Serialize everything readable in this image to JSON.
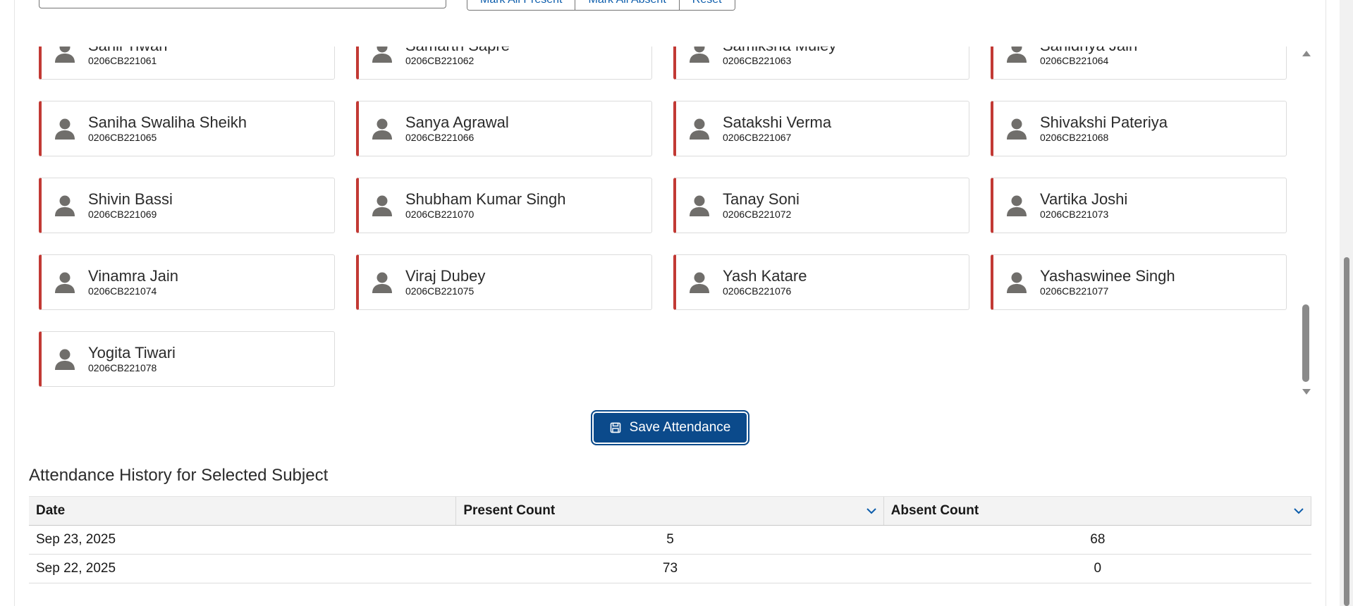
{
  "controls": {
    "mark_all_present": "Mark All Present",
    "mark_all_absent": "Mark All Absent",
    "reset": "Reset"
  },
  "students": [
    {
      "name": "Sahil Tiwari",
      "roll": "0206CB221061"
    },
    {
      "name": "Samarth Sapre",
      "roll": "0206CB221062"
    },
    {
      "name": "Samiksha Muley",
      "roll": "0206CB221063"
    },
    {
      "name": "Sanidhya Jain",
      "roll": "0206CB221064"
    },
    {
      "name": "Saniha Swaliha Sheikh",
      "roll": "0206CB221065"
    },
    {
      "name": "Sanya Agrawal",
      "roll": "0206CB221066"
    },
    {
      "name": "Satakshi Verma",
      "roll": "0206CB221067"
    },
    {
      "name": "Shivakshi Pateriya",
      "roll": "0206CB221068"
    },
    {
      "name": "Shivin Bassi",
      "roll": "0206CB221069"
    },
    {
      "name": "Shubham Kumar Singh",
      "roll": "0206CB221070"
    },
    {
      "name": "Tanay Soni",
      "roll": "0206CB221072"
    },
    {
      "name": "Vartika Joshi",
      "roll": "0206CB221073"
    },
    {
      "name": "Vinamra Jain",
      "roll": "0206CB221074"
    },
    {
      "name": "Viraj Dubey",
      "roll": "0206CB221075"
    },
    {
      "name": "Yash Katare",
      "roll": "0206CB221076"
    },
    {
      "name": "Yashaswinee Singh",
      "roll": "0206CB221077"
    },
    {
      "name": "Yogita Tiwari",
      "roll": "0206CB221078"
    }
  ],
  "save_button": {
    "label": "Save Attendance",
    "icon": "save-icon"
  },
  "history": {
    "title": "Attendance History for Selected Subject",
    "columns": [
      "Date",
      "Present Count",
      "Absent Count"
    ],
    "rows": [
      {
        "date": "Sep 23, 2025",
        "present": "5",
        "absent": "68"
      },
      {
        "date": "Sep 22, 2025",
        "present": "73",
        "absent": "0"
      }
    ]
  },
  "colors": {
    "absent_marker": "#c23934",
    "brand": "#0b4a8b",
    "link": "#0b5cab"
  }
}
